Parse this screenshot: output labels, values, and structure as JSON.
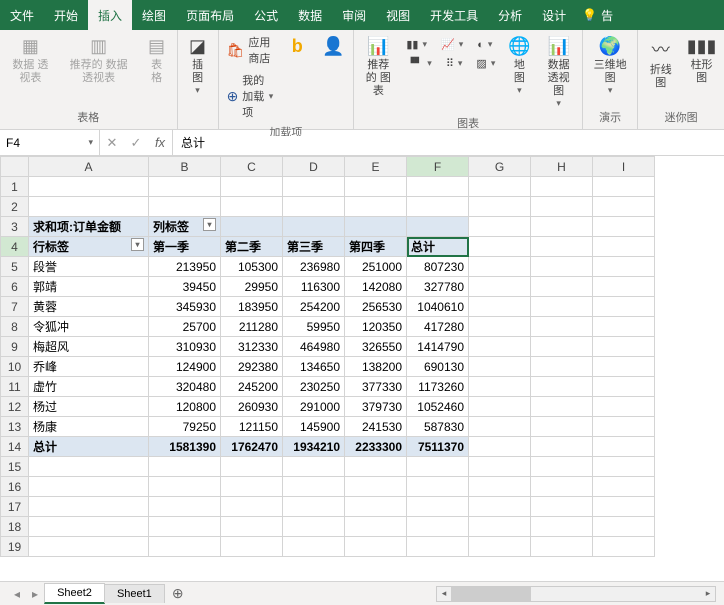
{
  "tabs": {
    "file": "文件",
    "home": "开始",
    "insert": "插入",
    "draw": "绘图",
    "layout": "页面布局",
    "formulas": "公式",
    "data": "数据",
    "review": "审阅",
    "view": "视图",
    "dev": "开发工具",
    "analyze": "分析",
    "design": "设计",
    "tell": "告"
  },
  "ribbon": {
    "group_tables": "表格",
    "group_addins": "加载项",
    "group_charts": "图表",
    "group_demo": "演示",
    "group_mini": "迷你图",
    "pivot_table": "数据\n透视表",
    "rec_pivot": "推荐的\n数据透视表",
    "table": "表格",
    "illus": "插图",
    "store": "应用商店",
    "myaddins": "我的加载项",
    "bing": "",
    "ppl": "",
    "rec_chart": "推荐的\n图表",
    "maps": "地图",
    "pivot_chart": "数据透视图",
    "map3d": "三维地\n图",
    "sparkline_line": "折线图",
    "sparkline_col": "柱形图"
  },
  "namebox": "F4",
  "formula": "总计",
  "cols": [
    "A",
    "B",
    "C",
    "D",
    "E",
    "F",
    "G",
    "H",
    "I"
  ],
  "pivot": {
    "sum_label": "求和项:订单金额",
    "col_label": "列标签",
    "row_label": "行标签",
    "col_headers": [
      "第一季",
      "第二季",
      "第三季",
      "第四季",
      "总计"
    ],
    "rows": [
      {
        "name": "段誉",
        "v": [
          213950,
          105300,
          236980,
          251000,
          807230
        ]
      },
      {
        "name": "郭靖",
        "v": [
          39450,
          29950,
          116300,
          142080,
          327780
        ]
      },
      {
        "name": "黄蓉",
        "v": [
          345930,
          183950,
          254200,
          256530,
          1040610
        ]
      },
      {
        "name": "令狐冲",
        "v": [
          25700,
          211280,
          59950,
          120350,
          417280
        ]
      },
      {
        "name": "梅超风",
        "v": [
          310930,
          312330,
          464980,
          326550,
          1414790
        ]
      },
      {
        "name": "乔峰",
        "v": [
          124900,
          292380,
          134650,
          138200,
          690130
        ]
      },
      {
        "name": "虚竹",
        "v": [
          320480,
          245200,
          230250,
          377330,
          1173260
        ]
      },
      {
        "name": "杨过",
        "v": [
          120800,
          260930,
          291000,
          379730,
          1052460
        ]
      },
      {
        "name": "杨康",
        "v": [
          79250,
          121150,
          145900,
          241530,
          587830
        ]
      }
    ],
    "total_label": "总计",
    "totals": [
      1581390,
      1762470,
      1934210,
      2233300,
      7511370
    ]
  },
  "sheets": {
    "s2": "Sheet2",
    "s1": "Sheet1"
  },
  "chart_data": {
    "type": "table",
    "title": "求和项:订单金额",
    "columns": [
      "第一季",
      "第二季",
      "第三季",
      "第四季",
      "总计"
    ],
    "rows": [
      "段誉",
      "郭靖",
      "黄蓉",
      "令狐冲",
      "梅超风",
      "乔峰",
      "虚竹",
      "杨过",
      "杨康",
      "总计"
    ],
    "values": [
      [
        213950,
        105300,
        236980,
        251000,
        807230
      ],
      [
        39450,
        29950,
        116300,
        142080,
        327780
      ],
      [
        345930,
        183950,
        254200,
        256530,
        1040610
      ],
      [
        25700,
        211280,
        59950,
        120350,
        417280
      ],
      [
        310930,
        312330,
        464980,
        326550,
        1414790
      ],
      [
        124900,
        292380,
        134650,
        138200,
        690130
      ],
      [
        320480,
        245200,
        230250,
        377330,
        1173260
      ],
      [
        120800,
        260930,
        291000,
        379730,
        1052460
      ],
      [
        79250,
        121150,
        145900,
        241530,
        587830
      ],
      [
        1581390,
        1762470,
        1934210,
        2233300,
        7511370
      ]
    ]
  }
}
